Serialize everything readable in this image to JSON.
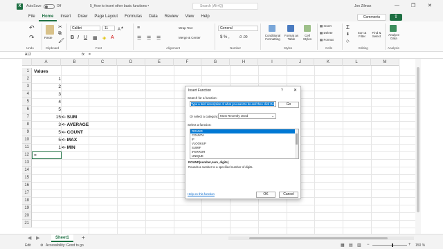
{
  "titlebar": {
    "app_icon": "X",
    "autosave_label": "AutoSave",
    "autosave_state": "Off",
    "doc_title": "5_How to insert other basic functions •",
    "search_placeholder": "Search (Alt+Q)",
    "user_name": "Jon Zilman",
    "minimize": "—",
    "restore": "❒",
    "close": "✕"
  },
  "tabs": [
    "File",
    "Home",
    "Insert",
    "Draw",
    "Page Layout",
    "Formulas",
    "Data",
    "Review",
    "View",
    "Help"
  ],
  "active_tab": "Home",
  "comments_label": "Comments",
  "share_icon": "share-icon",
  "ribbon": {
    "groups": [
      "Undo",
      "Clipboard",
      "Font",
      "Alignment",
      "Number",
      "Styles",
      "Cells",
      "Editing",
      "Analysis"
    ],
    "paste_label": "Paste",
    "font_name": "Calibri",
    "font_size": "11",
    "wrap_text": "Wrap Text",
    "merge_center": "Merge & Center",
    "number_format": "General",
    "cond_format": "Conditional Formatting",
    "format_table": "Format as Table",
    "cell_styles": "Cell Styles",
    "insert": "Insert",
    "delete": "Delete",
    "format": "Format",
    "sort_filter": "Sort & Filter",
    "find_select": "Find & Select",
    "analyze": "Analyze Data"
  },
  "formula_bar": {
    "name_box": "A12",
    "fx": "fx",
    "value": "="
  },
  "columns": [
    "A",
    "B",
    "C",
    "D",
    "E",
    "F",
    "G",
    "H",
    "I",
    "J",
    "K",
    "L",
    "M"
  ],
  "rows": [
    "1",
    "2",
    "3",
    "4",
    "5",
    "6",
    "7",
    "8",
    "9",
    "10",
    "11",
    "12",
    "13",
    "14",
    "15",
    "16",
    "17",
    "18",
    "19",
    "20",
    "21"
  ],
  "cells": {
    "A1": "Values",
    "A2": "1",
    "A3": "2",
    "A4": "3",
    "A5": "4",
    "A6": "5",
    "A7": "15",
    "A8": "3",
    "A9": "5",
    "A10": "5",
    "A11": "1",
    "A12": "=",
    "B7": "<- SUM",
    "B8": "<- AVERAGE",
    "B9": "<- COUNT",
    "B10": "<- MAX",
    "B11": "<- MIN"
  },
  "sheet_tab": "Sheet1",
  "add_sheet": "+",
  "status": {
    "mode": "Edit",
    "accessibility": "Accessibility: Good to go",
    "zoom": "150 %"
  },
  "dialog": {
    "title": "Insert Function",
    "help_btn": "?",
    "close_btn": "✕",
    "search_label": "Search for a function:",
    "search_text": "Type a brief description of what you want to do and then click Go",
    "go_button": "Go",
    "category_label": "Or select a category:",
    "category_value": "Most Recently Used",
    "select_label": "Select a function:",
    "functions": [
      "ROUND",
      "COUNTA",
      "IF",
      "VLOOKUP",
      "SUMIF",
      "IFERROR",
      "UNIQUE"
    ],
    "selected_function": "ROUND",
    "signature": "ROUND(number,num_digits)",
    "description": "Rounds a number to a specified number of digits.",
    "help_link": "Help on this function",
    "ok": "OK",
    "cancel": "Cancel"
  }
}
